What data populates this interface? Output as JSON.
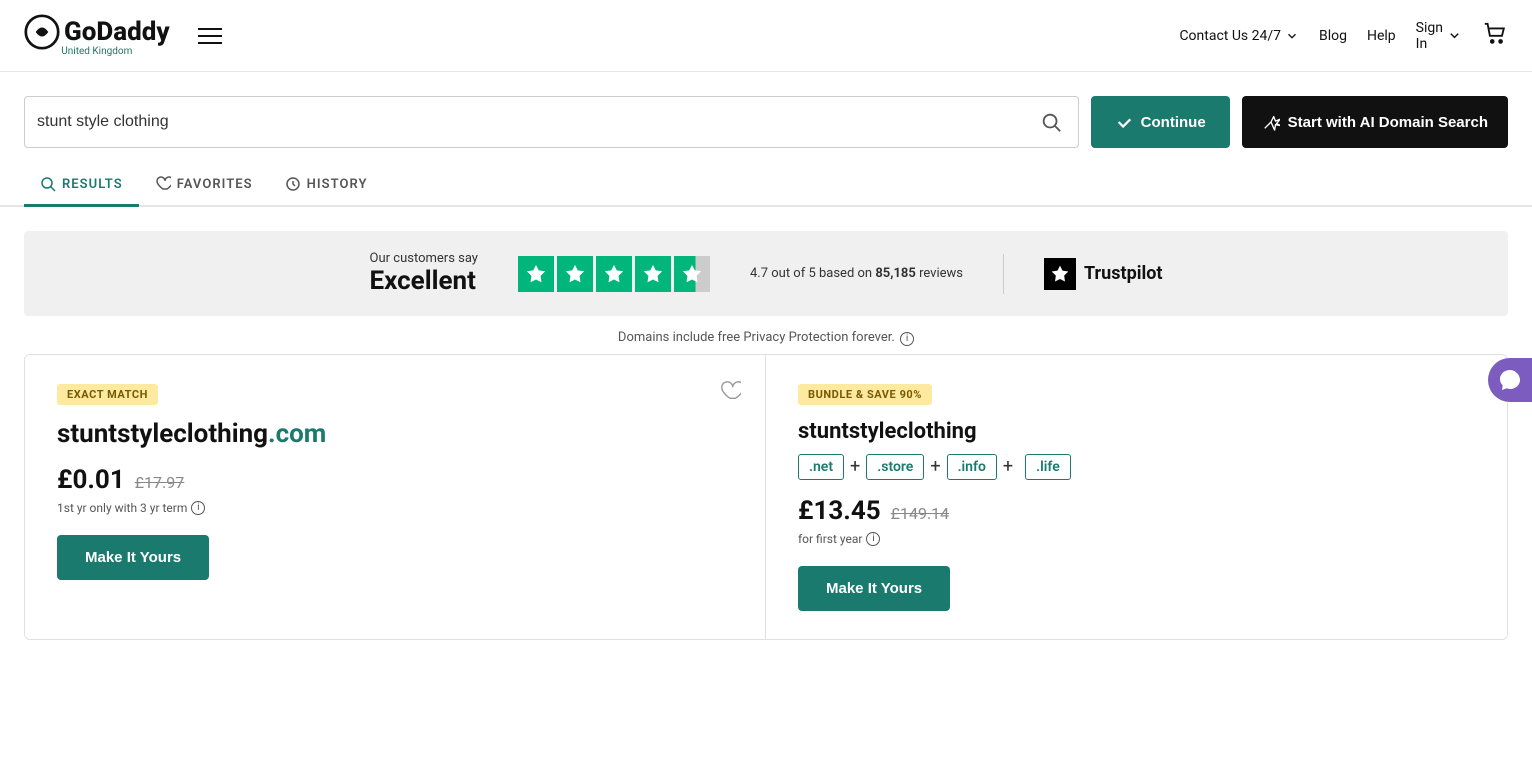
{
  "brand": {
    "name": "GoDaddy",
    "region": "United Kingdom"
  },
  "header": {
    "contact_label": "Contact Us 24/7",
    "blog_label": "Blog",
    "help_label": "Help",
    "sign_in_label": "Sign In"
  },
  "search": {
    "query": "stunt style clothing",
    "placeholder": "stunt style clothing",
    "continue_label": "Continue",
    "ai_search_label": "Start with AI Domain Search"
  },
  "tabs": [
    {
      "id": "results",
      "label": "RESULTS",
      "active": true
    },
    {
      "id": "favorites",
      "label": "FAVORITES",
      "active": false
    },
    {
      "id": "history",
      "label": "HISTORY",
      "active": false
    }
  ],
  "trustpilot": {
    "customers_say": "Our customers say",
    "rating_word": "Excellent",
    "score": "4.7 out of 5 based on",
    "reviews_count": "85,185",
    "reviews_label": "reviews",
    "logo_label": "Trustpilot"
  },
  "privacy_note": "Domains include free Privacy Protection forever.",
  "results": [
    {
      "badge": "EXACT MATCH",
      "badge_type": "exact",
      "domain_base": "stuntstyleclothing",
      "domain_tld": ".com",
      "price_main": "£0.01",
      "price_original": "£17.97",
      "price_note": "1st yr only with 3 yr term",
      "cta_label": "Make It Yours"
    },
    {
      "badge": "BUNDLE & SAVE 90%",
      "badge_type": "bundle",
      "domain_base": "stuntstyleclothing",
      "tlds": [
        ".net",
        ".store",
        ".info",
        ".life"
      ],
      "price_main": "£13.45",
      "price_original": "£149.14",
      "price_note": "for first year",
      "cta_label": "Make It Yours"
    }
  ]
}
